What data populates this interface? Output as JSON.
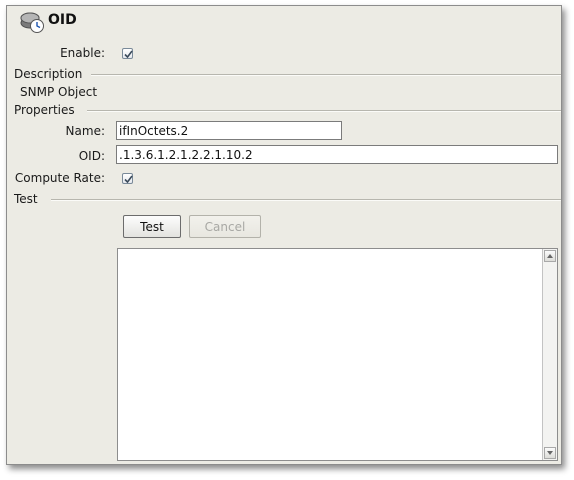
{
  "window": {
    "title": "OID",
    "icon": "snmp-oid-icon"
  },
  "form": {
    "enable_label": "Enable:",
    "enable_checked": true,
    "description_section": "Description",
    "description_text": "SNMP Object",
    "properties_section": "Properties",
    "name_label": "Name:",
    "name_value": "ifInOctets.2",
    "oid_label": "OID:",
    "oid_value": ".1.3.6.1.2.1.2.2.1.10.2",
    "compute_rate_label": "Compute Rate:",
    "compute_rate_checked": true,
    "test_section": "Test"
  },
  "actions": {
    "test_label": "Test",
    "cancel_label": "Cancel",
    "cancel_enabled": false
  },
  "output": {
    "text": ""
  },
  "colors": {
    "panel_background": "#ecebe4",
    "checkmark": "#3a4a5a"
  }
}
